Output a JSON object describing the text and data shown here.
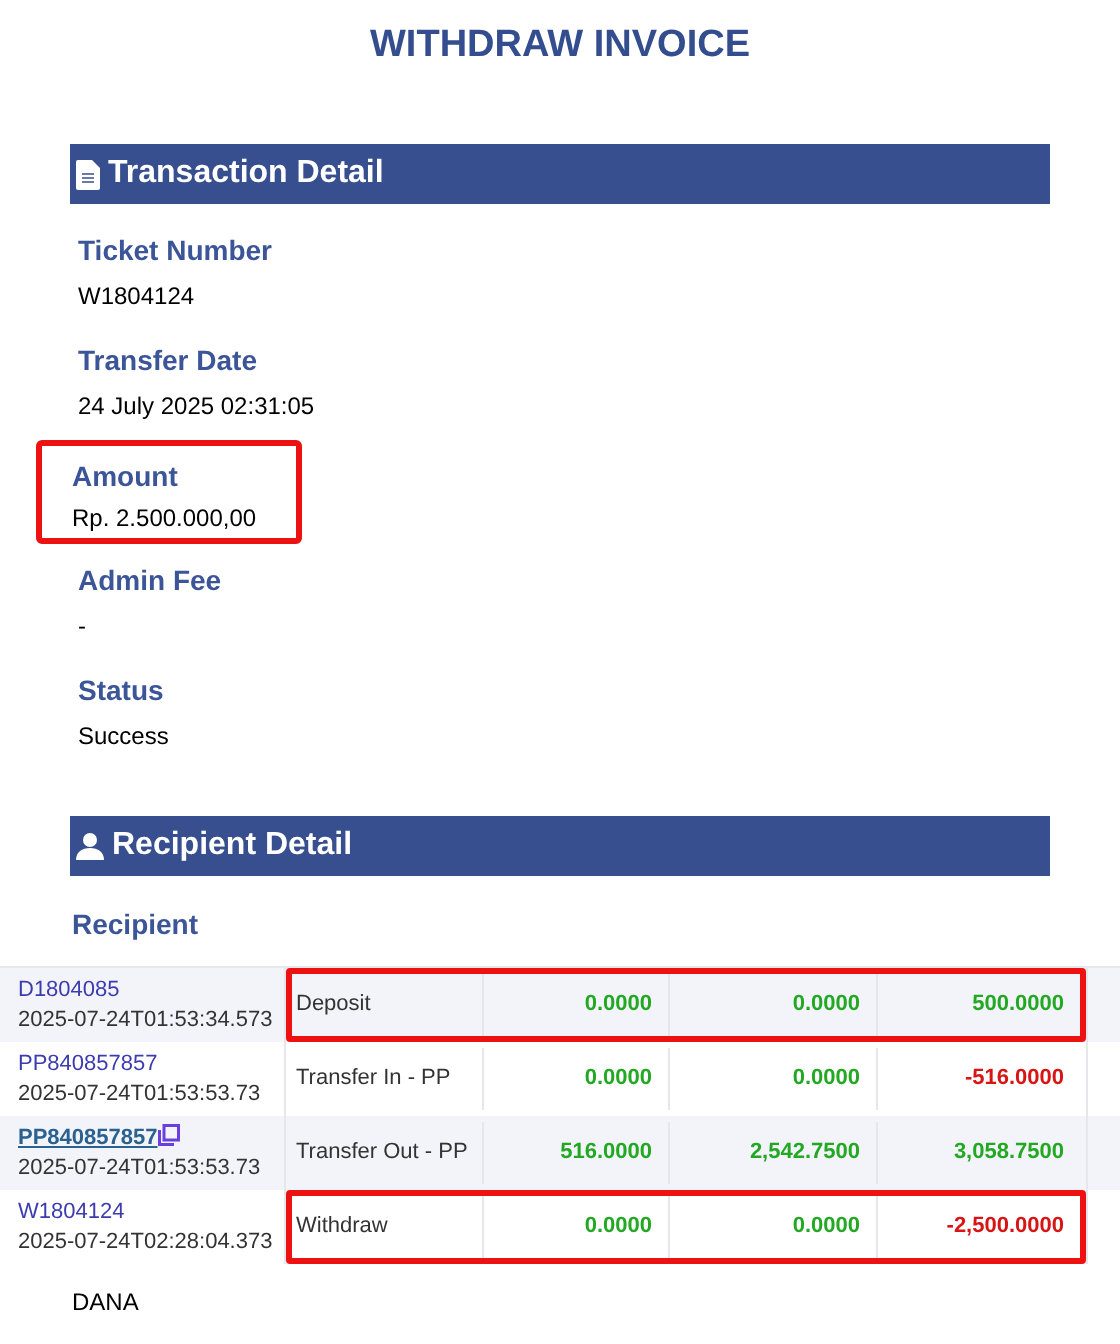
{
  "title": "WITHDRAW INVOICE",
  "transaction": {
    "heading": "Transaction Detail",
    "fields": [
      {
        "label": "Ticket Number",
        "value": "W1804124",
        "highlighted": false
      },
      {
        "label": "Transfer Date",
        "value": "24 July 2025 02:31:05",
        "highlighted": false
      },
      {
        "label": "Amount",
        "value": "Rp. 2.500.000,00",
        "highlighted": true
      },
      {
        "label": "Admin Fee",
        "value": "-",
        "highlighted": false
      },
      {
        "label": "Status",
        "value": "Success",
        "highlighted": false
      }
    ]
  },
  "recipient": {
    "heading": "Recipient Detail",
    "label": "Recipient"
  },
  "ledger": {
    "rows": [
      {
        "ref": "D1804085",
        "linked": false,
        "time": "2025-07-24T01:53:34.573",
        "type": "Deposit",
        "highlighted": true,
        "amounts": [
          {
            "text": "0.0000",
            "negative": false
          },
          {
            "text": "0.0000",
            "negative": false
          },
          {
            "text": "500.0000",
            "negative": false
          }
        ]
      },
      {
        "ref": "PP840857857",
        "linked": false,
        "time": "2025-07-24T01:53:53.73",
        "type": "Transfer In - PP",
        "highlighted": false,
        "amounts": [
          {
            "text": "0.0000",
            "negative": false
          },
          {
            "text": "0.0000",
            "negative": false
          },
          {
            "text": "-516.0000",
            "negative": true
          }
        ]
      },
      {
        "ref": "PP840857857",
        "linked": true,
        "time": "2025-07-24T01:53:53.73",
        "type": "Transfer Out - PP",
        "highlighted": false,
        "amounts": [
          {
            "text": "516.0000",
            "negative": false
          },
          {
            "text": "2,542.7500",
            "negative": false
          },
          {
            "text": "3,058.7500",
            "negative": false
          }
        ]
      },
      {
        "ref": "W1804124",
        "linked": false,
        "time": "2025-07-24T02:28:04.373",
        "type": "Withdraw",
        "highlighted": true,
        "amounts": [
          {
            "text": "0.0000",
            "negative": false
          },
          {
            "text": "0.0000",
            "negative": false
          },
          {
            "text": "-2,500.0000",
            "negative": true
          }
        ]
      }
    ]
  },
  "bank": {
    "value": "DANA"
  }
}
